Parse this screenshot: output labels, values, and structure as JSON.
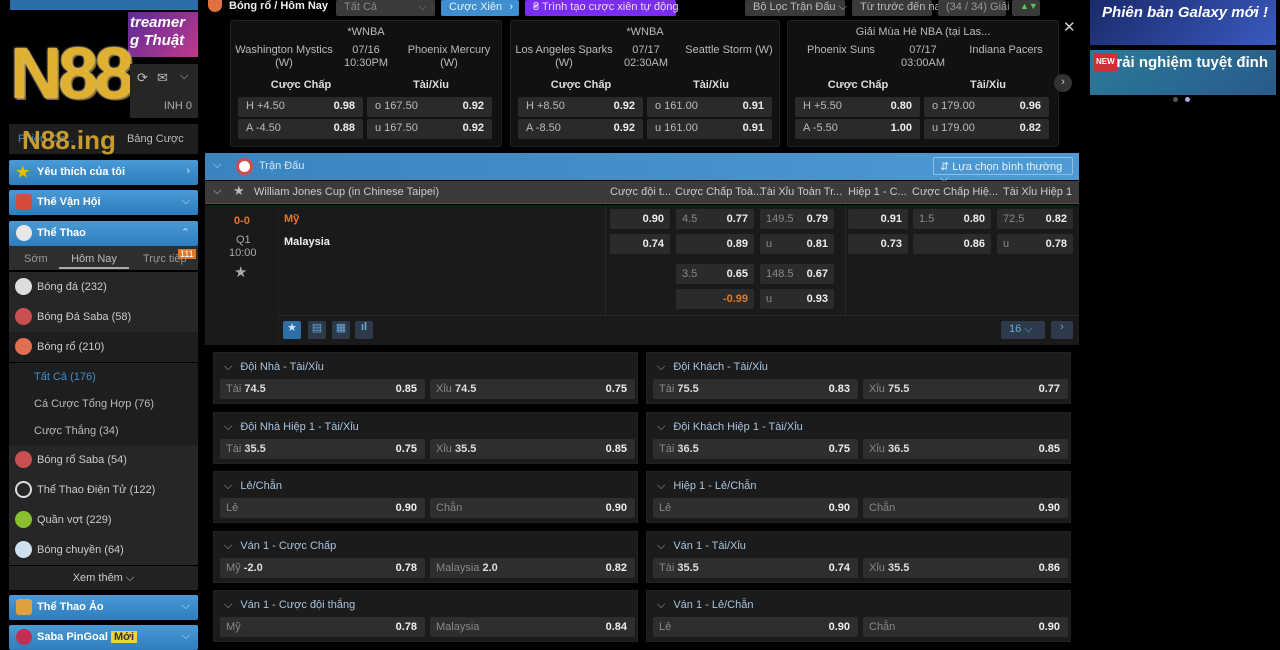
{
  "brand": {
    "logo": "N88",
    "domain": "N88.ing",
    "banner_text": "treamer g Thuật"
  },
  "account": {
    "balance": "INH 0",
    "bet_list": "Bảng Cược",
    "my_bets": "Phiếu Cư..."
  },
  "topbar": {
    "breadcrumb": "Bóng rổ / Hôm Nay",
    "select": "Tất Cả",
    "parlay": "Cược Xiên",
    "auto_parlay": "Trình tạo cược xiên tự động",
    "filter": "Bộ Lọc Trận Đấu",
    "sort": "Từ trước đến nay",
    "leagues": "(34 / 34) Giải"
  },
  "featured": [
    {
      "league": "*WNBA",
      "home": "Washington Mystics (W)",
      "away": "Phoenix Mercury (W)",
      "date": "07/16",
      "time": "10:30PM",
      "h1": "H +4.50",
      "h1o": "0.98",
      "h2": "A -4.50",
      "h2o": "0.88",
      "t1": "o 167.50",
      "t1o": "0.92",
      "t2": "u 167.50",
      "t2o": "0.92"
    },
    {
      "league": "*WNBA",
      "home": "Los Angeles Sparks (W)",
      "away": "Seattle Storm (W)",
      "date": "07/17",
      "time": "02:30AM",
      "h1": "H +8.50",
      "h1o": "0.92",
      "h2": "A -8.50",
      "h2o": "0.92",
      "t1": "o 161.00",
      "t1o": "0.91",
      "t2": "u 161.00",
      "t2o": "0.91"
    },
    {
      "league": "Giải Mùa Hè NBA (tại Las...",
      "home": "Phoenix Suns",
      "away": "Indiana Pacers",
      "date": "07/17",
      "time": "03:00AM",
      "h1": "H +5.50",
      "h1o": "0.80",
      "h2": "A -5.50",
      "h2o": "1.00",
      "t1": "o 179.00",
      "t1o": "0.96",
      "t2": "u 179.00",
      "t2o": "0.82"
    }
  ],
  "featured_headers": {
    "handicap": "Cược Chấp",
    "ou": "Tài/Xỉu"
  },
  "promo": {
    "b1": "Phiên bản Galaxy mới !",
    "b2": "Trải nghiệm tuyệt đỉnh",
    "b2_tag": "NEW"
  },
  "sidebar": {
    "fav": "Yêu thích của tôi",
    "olympics": "Thế Vận Hội",
    "sports": "Thể Thao",
    "tabs": [
      "Sớm",
      "Hôm Nay",
      "Trực tiếp"
    ],
    "live_count": "111",
    "items": [
      {
        "label": "Bóng đá",
        "count": "(232)"
      },
      {
        "label": "Bóng Đá Saba",
        "count": "(58)"
      },
      {
        "label": "Bóng rổ",
        "count": "(210)"
      }
    ],
    "subitems": [
      {
        "label": "Tất Cả",
        "count": "(176)"
      },
      {
        "label": "Cá Cược Tổng Hợp",
        "count": "(76)"
      },
      {
        "label": "Cược Thắng",
        "count": "(34)"
      }
    ],
    "items2": [
      {
        "label": "Bóng rổ Saba",
        "count": "(54)"
      },
      {
        "label": "Thể Thao Điện Tử",
        "count": "(122)"
      },
      {
        "label": "Quần vợt",
        "count": "(229)"
      },
      {
        "label": "Bóng chuyền",
        "count": "(64)"
      }
    ],
    "more": "Xem thêm",
    "virtual": "Thể Thao Ảo",
    "pingoal": "Saba PinGoal",
    "new_badge": "Mới"
  },
  "main": {
    "section": "Trận Đấu",
    "view": "Lựa chọn bình thường",
    "league": "William Jones Cup (in Chinese Taipei)",
    "cols": [
      "Cược đội t...",
      "Cược Chấp Toà...",
      "Tài Xỉu Toàn Tr...",
      "Hiệp 1 - C...",
      "Cược Chấp Hiệ...",
      "Tài Xỉu Hiệp 1"
    ],
    "match": {
      "score": "0-0",
      "period": "Q1",
      "clock": "10:00",
      "home": "Mỹ",
      "away": "Malaysia"
    },
    "odds": {
      "r1": [
        "0.90",
        "4.5",
        "0.77",
        "149.5",
        "0.79",
        "0.91",
        "1.5",
        "0.80",
        "72.5",
        "0.82"
      ],
      "r2": [
        "0.74",
        "0.89",
        "u",
        "0.81",
        "0.73",
        "0.86",
        "u",
        "0.78"
      ],
      "r3": [
        "3.5",
        "0.65",
        "148.5",
        "0.67"
      ],
      "r4": [
        "-0.99",
        "u",
        "0.93"
      ]
    },
    "more_count": "16"
  },
  "markets": [
    {
      "title": "Đội Nhà - Tài/Xỉu",
      "a": [
        "Tài",
        "74.5",
        "0.85"
      ],
      "b": [
        "Xỉu",
        "74.5",
        "0.75"
      ]
    },
    {
      "title": "Đội Khách - Tài/Xỉu",
      "a": [
        "Tài",
        "75.5",
        "0.83"
      ],
      "b": [
        "Xỉu",
        "75.5",
        "0.77"
      ]
    },
    {
      "title": "Đội Nhà Hiệp 1 - Tài/Xỉu",
      "a": [
        "Tài",
        "35.5",
        "0.75"
      ],
      "b": [
        "Xỉu",
        "35.5",
        "0.85"
      ]
    },
    {
      "title": "Đội Khách Hiệp 1 - Tài/Xỉu",
      "a": [
        "Tài",
        "36.5",
        "0.75"
      ],
      "b": [
        "Xỉu",
        "36.5",
        "0.85"
      ]
    },
    {
      "title": "Lẻ/Chẵn",
      "a": [
        "Lẻ",
        "",
        "0.90"
      ],
      "b": [
        "Chẵn",
        "",
        "0.90"
      ]
    },
    {
      "title": "Hiệp 1 - Lẻ/Chẵn",
      "a": [
        "Lẻ",
        "",
        "0.90"
      ],
      "b": [
        "Chẵn",
        "",
        "0.90"
      ]
    },
    {
      "title": "Ván 1 - Cược Chấp",
      "a": [
        "Mỹ",
        "-2.0",
        "0.78"
      ],
      "b": [
        "Malaysia",
        "2.0",
        "0.82"
      ]
    },
    {
      "title": "Ván 1 - Tài/Xỉu",
      "a": [
        "Tài",
        "35.5",
        "0.74"
      ],
      "b": [
        "Xỉu",
        "35.5",
        "0.86"
      ]
    },
    {
      "title": "Ván 1 - Cược đội thắng",
      "a": [
        "Mỹ",
        "",
        "0.78"
      ],
      "b": [
        "Malaysia",
        "",
        "0.84"
      ]
    },
    {
      "title": "Ván 1 - Lẻ/Chẵn",
      "a": [
        "Lẻ",
        "",
        "0.90"
      ],
      "b": [
        "Chẵn",
        "",
        "0.90"
      ]
    }
  ],
  "colors": {
    "accent": "#3f8fd0",
    "purple": "#7a2cf0",
    "orange": "#e0782a",
    "gold": "#d8a830"
  }
}
